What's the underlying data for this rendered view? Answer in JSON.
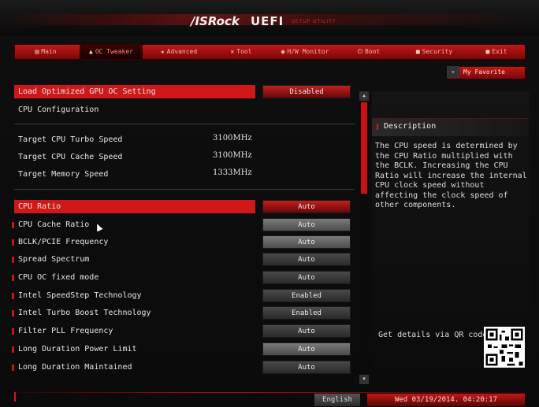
{
  "header": {
    "brand": "/ISRock",
    "uefi": "UEFI",
    "setup": "SETUP UTILITY"
  },
  "tabs": [
    {
      "label": "Main",
      "icon": "main-icon",
      "glyph": "▤"
    },
    {
      "label": "OC Tweaker",
      "icon": "oc-tweaker-icon",
      "glyph": "▲",
      "active": true
    },
    {
      "label": "Advanced",
      "icon": "advanced-icon",
      "glyph": "★"
    },
    {
      "label": "Tool",
      "icon": "tool-icon",
      "glyph": "✕"
    },
    {
      "label": "H/W Monitor",
      "icon": "hw-monitor-icon",
      "glyph": "◉"
    },
    {
      "label": "Boot",
      "icon": "boot-icon",
      "glyph": "⏻"
    },
    {
      "label": "Security",
      "icon": "security-icon",
      "glyph": "■"
    },
    {
      "label": "Exit",
      "icon": "exit-icon",
      "glyph": "■"
    }
  ],
  "favorite": {
    "label": "My Favorite",
    "dropdown_glyph": "▾"
  },
  "top_items": {
    "load_gpu_oc": {
      "label": "Load Optimized GPU OC Setting",
      "value": "Disabled"
    },
    "cpu_config": "CPU Configuration"
  },
  "targets": [
    {
      "label": "Target CPU Turbo Speed",
      "value": "3100MHz"
    },
    {
      "label": "Target CPU Cache Speed",
      "value": "3100MHz"
    },
    {
      "label": "Target Memory Speed",
      "value": "1333MHz"
    }
  ],
  "settings": [
    {
      "label": "CPU Ratio",
      "value": "Auto"
    },
    {
      "label": "CPU Cache Ratio",
      "value": "Auto"
    },
    {
      "label": "BCLK/PCIE Frequency",
      "value": "Auto"
    },
    {
      "label": "Spread Spectrum",
      "value": "Auto"
    },
    {
      "label": "CPU OC fixed mode",
      "value": "Auto"
    },
    {
      "label": "Intel SpeedStep Technology",
      "value": "Enabled"
    },
    {
      "label": "Intel Turbo Boost Technology",
      "value": "Enabled"
    },
    {
      "label": "Filter PLL Frequency",
      "value": "Auto"
    },
    {
      "label": "Long Duration Power Limit",
      "value": "Auto"
    },
    {
      "label": "Long Duration Maintained",
      "value": "Auto"
    }
  ],
  "description": {
    "title": "Description",
    "text": "The CPU speed is determined by the CPU Ratio multiplied with the BCLK. Increasing the CPU Ratio will increase the internal CPU clock speed without affecting the clock speed of other components.",
    "qr_label": "Get details via QR code"
  },
  "footer": {
    "language": "English",
    "datetime": "Wed 03/19/2014. 04:20:17"
  },
  "colors": {
    "accent": "#d01818",
    "background": "#0b0b0b",
    "text": "#e6e6e6"
  }
}
